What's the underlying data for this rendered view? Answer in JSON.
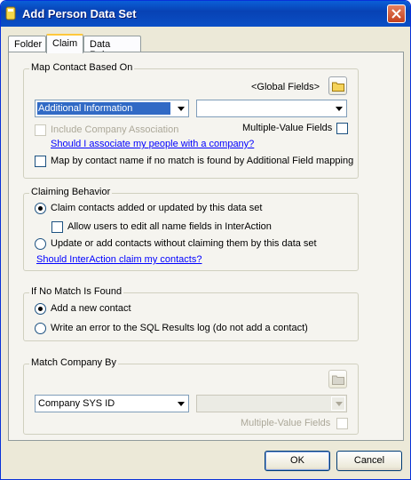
{
  "window": {
    "title": "Add Person Data Set"
  },
  "tabs": [
    {
      "label": "Folder"
    },
    {
      "label": "Claim"
    },
    {
      "label": "Data Rules"
    }
  ],
  "map_contact": {
    "legend": "Map Contact Based On",
    "global_fields_label": "<Global Fields>",
    "field_combo_value": "Additional Information",
    "value_combo_value": "",
    "include_company_label": "Include Company Association",
    "multi_value_label": "Multiple-Value Fields",
    "associate_link": "Should I associate my people with a company?",
    "map_by_name_label": "Map by contact name if no match is found by Additional Field mapping"
  },
  "claiming": {
    "legend": "Claiming Behavior",
    "claim_option": "Claim contacts added or updated by this data set",
    "allow_edit_label": "Allow users to edit all name fields in InterAction",
    "update_option": "Update or add contacts without claiming them by this data set",
    "claim_link": "Should InterAction claim my contacts?"
  },
  "no_match": {
    "legend": "If No Match Is Found",
    "add_option": "Add a new contact",
    "write_option": "Write an error to the SQL Results log (do not add a contact)"
  },
  "match_company": {
    "legend": "Match Company By",
    "company_combo_value": "Company SYS ID",
    "value_combo_value": "",
    "multi_value_label": "Multiple-Value Fields"
  },
  "buttons": {
    "ok": "OK",
    "cancel": "Cancel"
  }
}
